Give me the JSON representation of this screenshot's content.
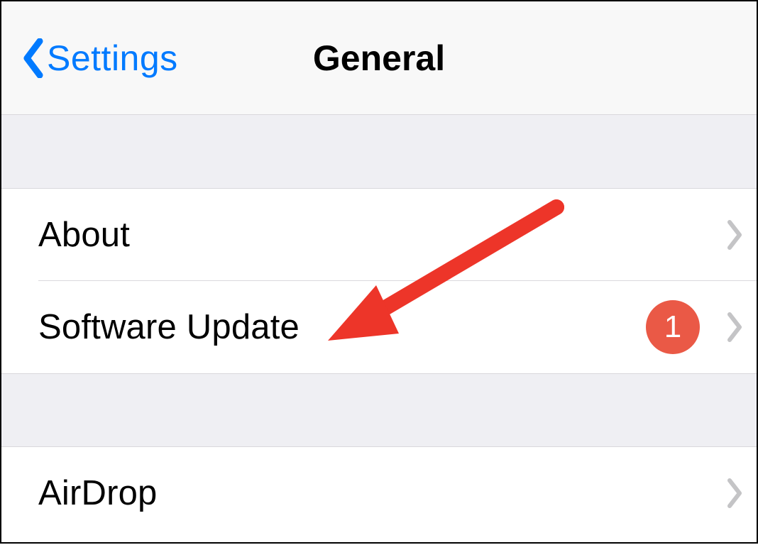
{
  "nav": {
    "back_label": "Settings",
    "title": "General"
  },
  "group1": {
    "items": [
      {
        "label": "About"
      },
      {
        "label": "Software Update",
        "badge": "1"
      }
    ]
  },
  "group2": {
    "items": [
      {
        "label": "AirDrop"
      }
    ]
  },
  "colors": {
    "tint": "#007aff",
    "badge": "#ea5946",
    "annotation": "#ed3529"
  }
}
